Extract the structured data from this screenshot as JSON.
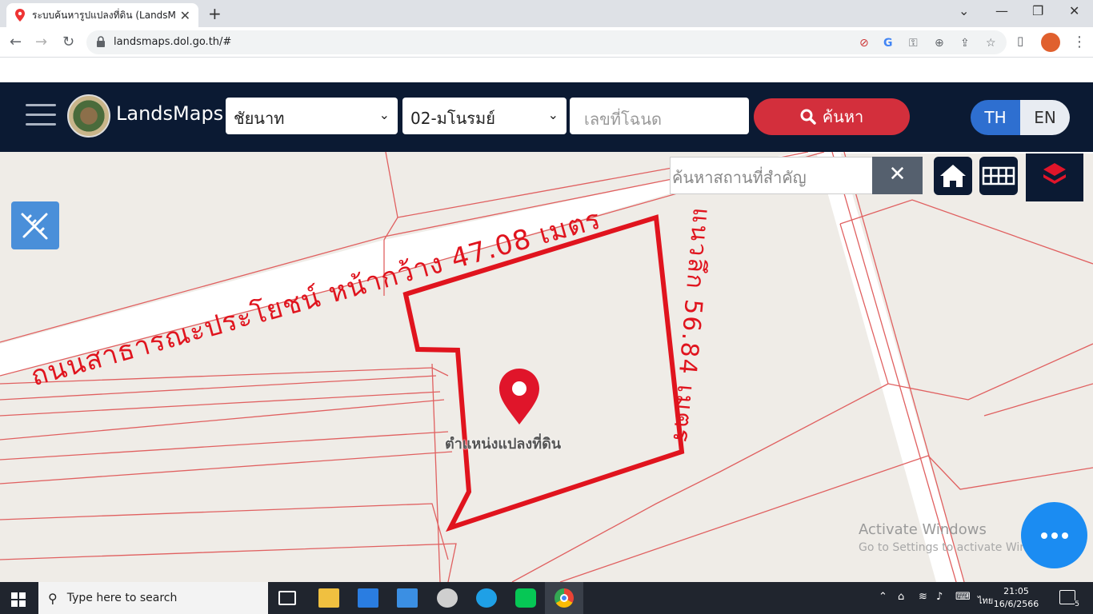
{
  "browser": {
    "tab_title": "ระบบค้นหารูปแปลงที่ดิน (LandsMaps",
    "tab_close": "✕",
    "new_tab": "+",
    "url": "landsmaps.dol.go.th/#",
    "win_minimize": "—",
    "win_restore": "❐",
    "win_close": "✕",
    "win_dropdown": "⌄"
  },
  "header": {
    "brand": "LandsMaps",
    "province": "ชัยนาท",
    "district": "02-มโนรมย์",
    "deed_placeholder": "เลขที่โฉนด",
    "search_label": "ค้นหา",
    "lang_th": "TH",
    "lang_en": "EN"
  },
  "map": {
    "place_search_placeholder": "ค้นหาสถานที่สำคัญ",
    "road_label": "ถนนสาธารณะประโยชน์ หน้ากว้าง 47.08 เมตร",
    "side_label": "แนวลึก 56.84 เมตร",
    "marker_label": "ตำแหน่งแปลงที่ดิน",
    "clear_label": "✕",
    "watermark_title": "Activate Windows",
    "watermark_sub": "Go to Settings to activate Windows."
  },
  "taskbar": {
    "search_placeholder": "Type here to search",
    "time": "21:05",
    "date": "16/6/2566",
    "lang": "ไทย",
    "notification_count": "5"
  },
  "colors": {
    "header_bg": "#0b1a33",
    "accent_red": "#d32f3c",
    "lang_active": "#2e6fd0",
    "parcel_line": "#e0141e",
    "fab": "#1b8cf2"
  }
}
